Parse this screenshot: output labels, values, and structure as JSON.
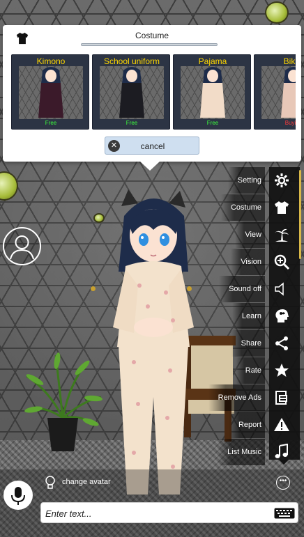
{
  "costume_panel": {
    "title": "Costume",
    "icon": "shirt-icon",
    "outfits": [
      {
        "name": "Kimono",
        "price": "Free",
        "price_color": "#3cff3c",
        "outfit_color": "#3b1a2a"
      },
      {
        "name": "School uniform",
        "price": "Free",
        "price_color": "#3cff3c",
        "outfit_color": "#1c1c22"
      },
      {
        "name": "Pajama",
        "price": "Free",
        "price_color": "#3cff3c",
        "outfit_color": "#f2dcc8"
      },
      {
        "name": "Bikini",
        "price": "Buying",
        "price_color": "#ff3b3b",
        "outfit_color": "#e8c8b8"
      }
    ],
    "cancel_label": "cancel"
  },
  "menu": {
    "items": [
      {
        "label": "Setting",
        "icon": "gear-icon"
      },
      {
        "label": "Costume",
        "icon": "shirt-icon"
      },
      {
        "label": "View",
        "icon": "palm-tree-icon"
      },
      {
        "label": "Vision",
        "icon": "zoom-in-icon"
      },
      {
        "label": "Sound off",
        "icon": "speaker-icon"
      },
      {
        "label": "Learn",
        "icon": "brain-head-icon"
      },
      {
        "label": "Share",
        "icon": "share-icon"
      },
      {
        "label": "Rate",
        "icon": "star-icon"
      },
      {
        "label": "Remove Ads",
        "icon": "remove-ads-icon"
      },
      {
        "label": "Report",
        "icon": "warning-icon"
      },
      {
        "label": "List Music",
        "icon": "music-note-icon"
      }
    ]
  },
  "bottom_bar": {
    "hint_text": "change avatar",
    "input_placeholder": "Enter text...",
    "mic_icon": "microphone-icon",
    "keyboard_icon": "keyboard-icon",
    "more_icon": "more-dots-icon",
    "hint_icon": "lightbulb-icon"
  },
  "colors": {
    "outfit_name": "#ffd800",
    "free_price": "#3cff3c",
    "paid_price": "#ff3b3b",
    "menu_strip": "#111111",
    "cancel_button": "#cfdff0"
  }
}
